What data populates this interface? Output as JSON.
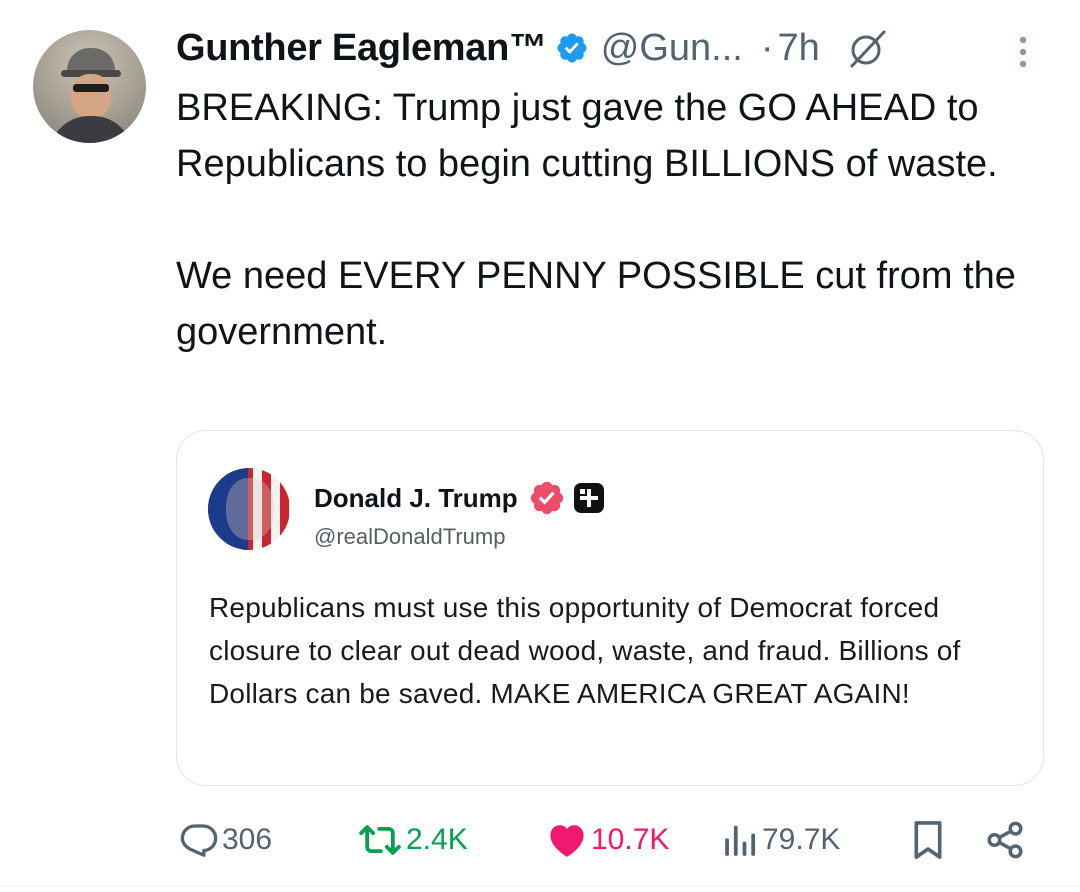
{
  "tweet": {
    "author": {
      "display_name": "Gunther Eagleman™",
      "handle": "@Gun...",
      "verified": true,
      "avatar_icon": "profile-photo"
    },
    "separator": "·",
    "time": "7h",
    "text": "BREAKING: Trump just gave the GO AHEAD to Republicans to begin cutting BILLIONS of waste.\n\nWe need EVERY PENNY POSSIBLE cut from the government."
  },
  "quote": {
    "display_name": "Donald J. Trump",
    "handle": "@realDonaldTrump",
    "text": "Republicans must use this opportunity of Democrat forced closure to clear out dead wood, waste, and fraud. Billions of Dollars can be saved. MAKE AMERICA GREAT AGAIN!"
  },
  "actions": {
    "replies": "306",
    "reposts": "2.4K",
    "likes": "10.7K",
    "views": "79.7K"
  },
  "colors": {
    "verified_blue": "#1d9bf0",
    "repost_green": "#00a14f",
    "like_pink": "#f0186f",
    "secondary_text": "#536471",
    "quote_badge": "#ee4d6a"
  }
}
